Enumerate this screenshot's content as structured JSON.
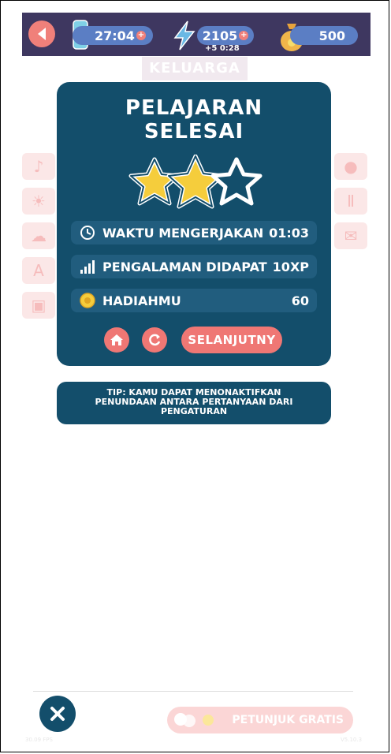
{
  "topbar": {
    "timer": "27:04",
    "energy": "2105",
    "energy_refill": "+5 0:28",
    "coins": "500"
  },
  "category": "KELUARGA",
  "modal": {
    "title_line1": "PELAJARAN",
    "title_line2": "SELESAI",
    "stars_earned": 2,
    "stars_total": 3,
    "stats": [
      {
        "label": "WAKTU MENGERJAKAN",
        "value": "01:03",
        "icon": "clock-icon"
      },
      {
        "label": "PENGALAMAN DIDAPAT",
        "value": "10XP",
        "icon": "xp-signal-icon"
      },
      {
        "label": "HADIAHMU",
        "value": "60",
        "icon": "coin-icon"
      }
    ],
    "next_label": "SELANJUTNY"
  },
  "tip": "TIP: KAMU DAPAT MENONAKTIFKAN PENUNDAAN ANTARA PERTANYAAN DARI PENGATURAN",
  "footer": {
    "hint_label": "PETUNJUK GRATIS",
    "fps": "30.09 FPS",
    "version": "V5.10.3"
  },
  "colors": {
    "topbar": "#3e3760",
    "panel": "#134e6b",
    "row": "#215d7e",
    "accent": "#ef7774",
    "star": "#f5cd3c"
  }
}
